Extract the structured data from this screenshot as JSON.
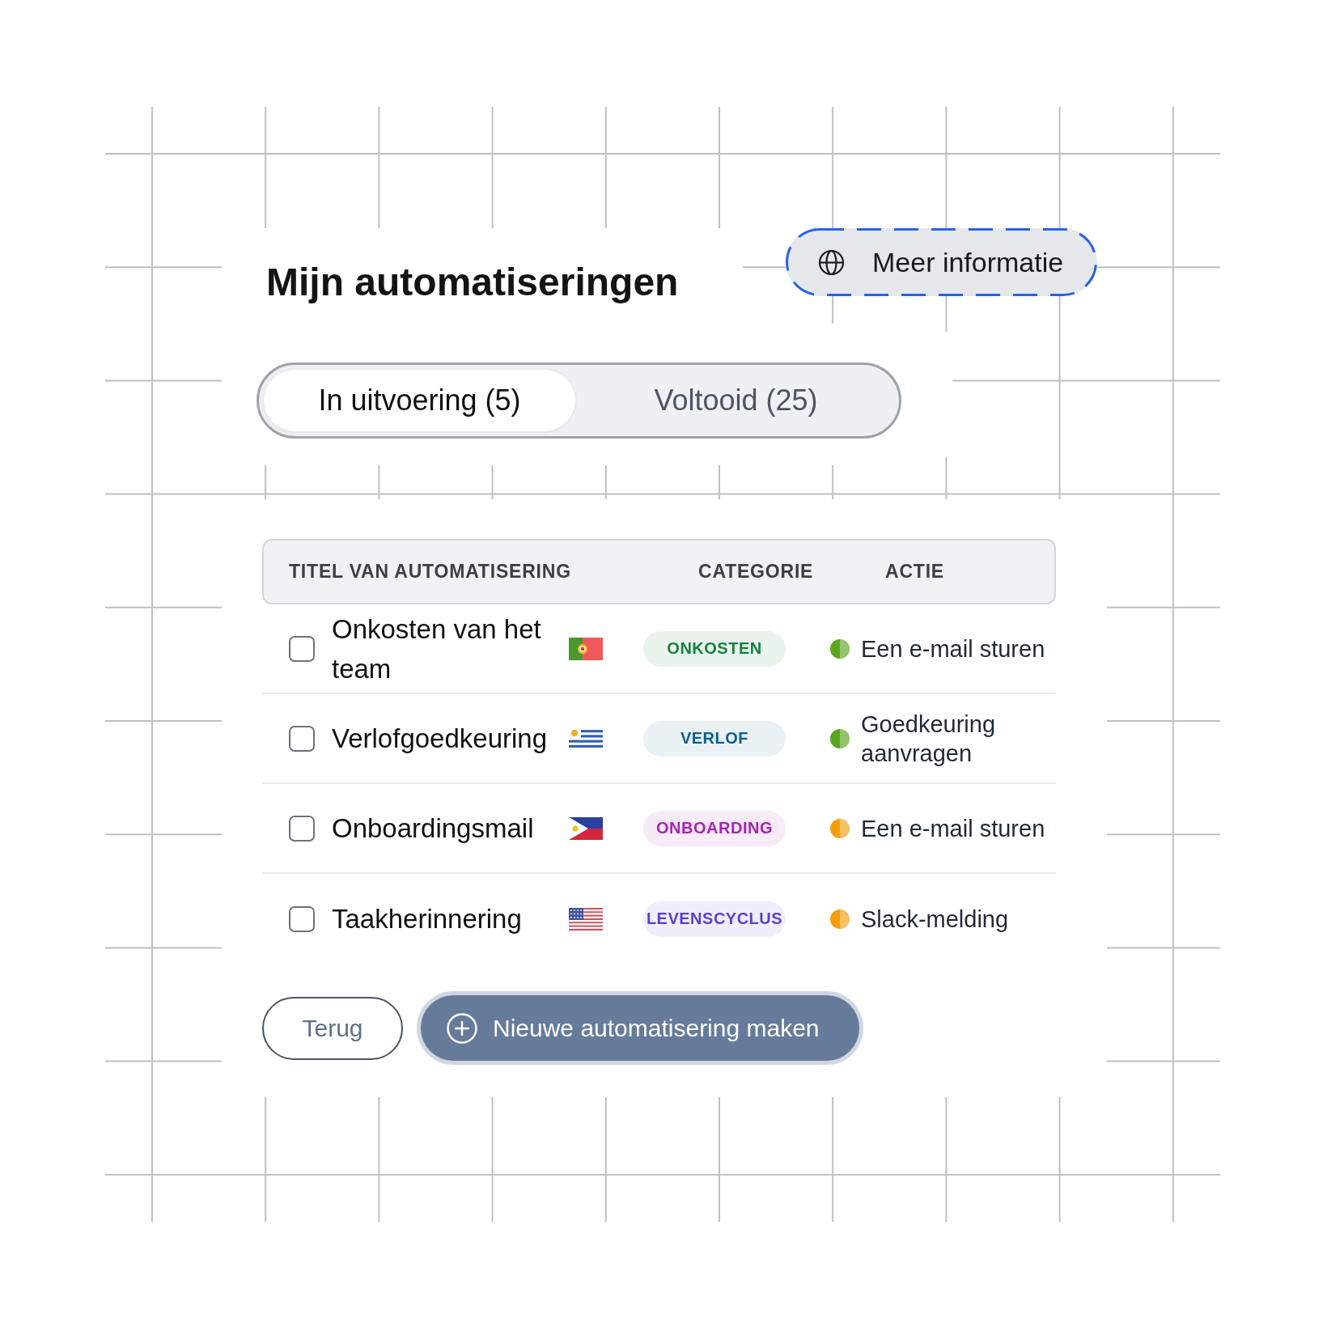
{
  "header": {
    "title": "Mijn automatiseringen",
    "info_button": "Meer informatie"
  },
  "tabs": [
    {
      "label": "In uitvoering (5)",
      "selected": true
    },
    {
      "label": "Voltooid (25)",
      "selected": false
    }
  ],
  "table": {
    "columns": [
      "TITEL VAN AUTOMATISERING",
      "CATEGORIE",
      "ACTIE"
    ],
    "rows": [
      {
        "checked": false,
        "title": "Onkosten van het team",
        "flag": {
          "kind": "portugal"
        },
        "category": {
          "label": "ONKOSTEN",
          "color": "#16803c"
        },
        "action": {
          "label": "Een e-mail sturen",
          "color": "#5aa51d"
        }
      },
      {
        "checked": false,
        "title": "Verlofgoedkeuring",
        "flag": {
          "kind": "uruguay"
        },
        "category": {
          "label": "VERLOF",
          "color": "#0c5f8f"
        },
        "action": {
          "label": "Goedkeuring aanvragen",
          "color": "#5aa51d"
        }
      },
      {
        "checked": false,
        "title": "Onboardingsmail",
        "flag": {
          "kind": "philippines"
        },
        "category": {
          "label": "ONBOARDING",
          "color": "#a823b4"
        },
        "action": {
          "label": "Een e-mail sturen",
          "color": "#f59e0b"
        }
      },
      {
        "checked": false,
        "title": "Taakherinnering",
        "flag": {
          "kind": "usa"
        },
        "category": {
          "label": "LEVENSCYCLUS",
          "color": "#5b3fd0"
        },
        "action": {
          "label": "Slack-melding",
          "color": "#f59e0b"
        }
      }
    ]
  },
  "buttons": [
    {
      "kind": "secondary",
      "label": "Terug"
    },
    {
      "kind": "primary",
      "label": "Nieuwe automatisering maken"
    }
  ]
}
